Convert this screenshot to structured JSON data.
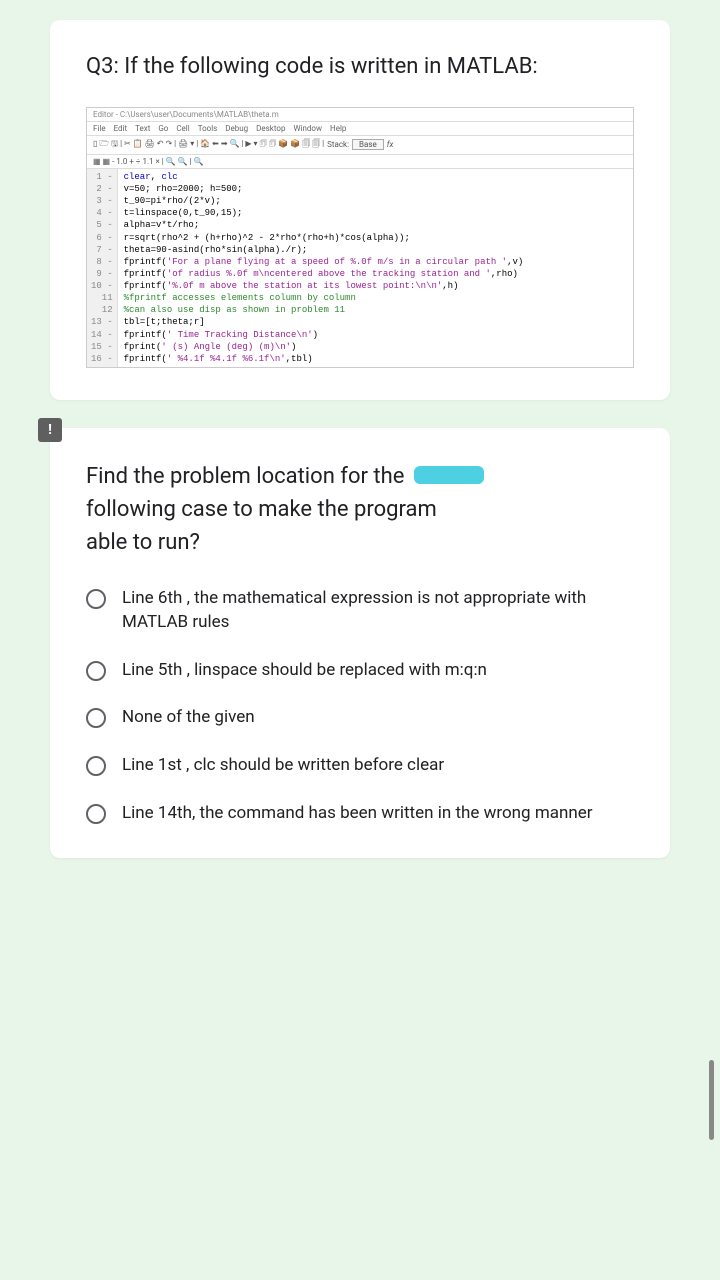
{
  "question": {
    "title": "Q3: If the following code is written in MATLAB:"
  },
  "editor": {
    "window_title": "Editor - C:\\Users\\user\\Documents\\MATLAB\\theta.m",
    "menu": [
      "File",
      "Edit",
      "Text",
      "Go",
      "Cell",
      "Tools",
      "Debug",
      "Desktop",
      "Window",
      "Help"
    ],
    "stack_label": "Stack:",
    "stack_value": "Base",
    "fx_label": "fx",
    "subbar": "- 1.0  +  ÷ 1.1  ×",
    "lines": [
      {
        "n": "1 -",
        "code": [
          {
            "c": "blue",
            "t": "clear"
          },
          {
            "c": "black",
            "t": ", "
          },
          {
            "c": "blue",
            "t": "clc"
          }
        ]
      },
      {
        "n": "2 -",
        "code": [
          {
            "c": "black",
            "t": "v=50; rho=2000; h=500;"
          }
        ]
      },
      {
        "n": "3 -",
        "code": [
          {
            "c": "black",
            "t": "t_90=pi*rho/(2*v);"
          }
        ]
      },
      {
        "n": "4 -",
        "code": [
          {
            "c": "black",
            "t": "t=linspace(0,t_90,15);"
          }
        ]
      },
      {
        "n": "5 -",
        "code": [
          {
            "c": "black",
            "t": "alpha=v*t/rho;"
          }
        ]
      },
      {
        "n": "6 -",
        "code": [
          {
            "c": "black",
            "t": "r=sqrt(rho^2 + (h+rho)^2 - 2*rho*(rho+h)*cos(alpha));"
          }
        ]
      },
      {
        "n": "7 -",
        "code": [
          {
            "c": "black",
            "t": "theta=90-asind(rho*sin(alpha)./r);"
          }
        ]
      },
      {
        "n": "8 -",
        "code": [
          {
            "c": "black",
            "t": "fprintf("
          },
          {
            "c": "purple",
            "t": "'For a plane flying at a speed of %.0f m/s in a circular path '"
          },
          {
            "c": "black",
            "t": ",v)"
          }
        ]
      },
      {
        "n": "9 -",
        "code": [
          {
            "c": "black",
            "t": "fprintf("
          },
          {
            "c": "purple",
            "t": "'of radius %.0f m\\ncentered above the tracking station and '"
          },
          {
            "c": "black",
            "t": ",rho)"
          }
        ]
      },
      {
        "n": "10 -",
        "code": [
          {
            "c": "black",
            "t": "fprintf("
          },
          {
            "c": "purple",
            "t": "'%.0f m above the station at its lowest point:\\n\\n'"
          },
          {
            "c": "black",
            "t": ",h)"
          }
        ]
      },
      {
        "n": "11",
        "code": [
          {
            "c": "green",
            "t": "%fprintf accesses elements column by column"
          }
        ]
      },
      {
        "n": "12",
        "code": [
          {
            "c": "green",
            "t": "%can also use disp as shown in problem 11"
          }
        ]
      },
      {
        "n": "13 -",
        "code": [
          {
            "c": "black",
            "t": "tbl=[t;theta;r]"
          }
        ]
      },
      {
        "n": "14 -",
        "code": [
          {
            "c": "black",
            "t": "fprintf("
          },
          {
            "c": "purple",
            "t": "' Time Tracking Distance\\n'"
          },
          {
            "c": "black",
            "t": ")"
          }
        ]
      },
      {
        "n": "15 -",
        "code": [
          {
            "c": "black",
            "t": "fprint("
          },
          {
            "c": "purple",
            "t": "' (s) Angle (deg) (m)\\n'"
          },
          {
            "c": "black",
            "t": ")"
          }
        ]
      },
      {
        "n": "16 -",
        "code": [
          {
            "c": "black",
            "t": "fprintf("
          },
          {
            "c": "purple",
            "t": "' %4.1f %4.1f %6.1f\\n'"
          },
          {
            "c": "black",
            "t": ",tbl)"
          }
        ]
      }
    ]
  },
  "prompt": {
    "line1": "Find the problem location for the",
    "line2": "following case to make the program",
    "line3": "able to run?"
  },
  "options": [
    "Line 6th , the mathematical expression is not appropriate with MATLAB rules",
    "Line 5th , linspace should be replaced with m:q:n",
    "None of the given",
    "Line 1st , clc should be written before clear",
    "Line 14th, the command has been written in the wrong manner"
  ],
  "alert": "!"
}
